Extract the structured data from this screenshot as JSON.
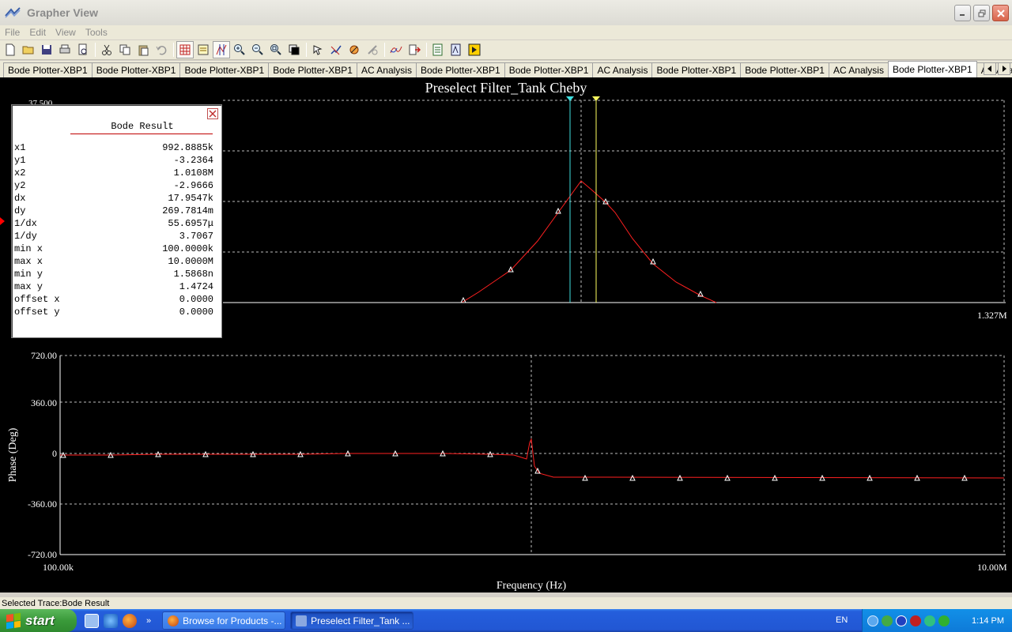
{
  "window": {
    "title": "Grapher View"
  },
  "menu": [
    "File",
    "Edit",
    "View",
    "Tools"
  ],
  "tabs": [
    {
      "label": "Bode Plotter-XBP1",
      "active": false
    },
    {
      "label": "Bode Plotter-XBP1",
      "active": false
    },
    {
      "label": "Bode Plotter-XBP1",
      "active": false
    },
    {
      "label": "Bode Plotter-XBP1",
      "active": false
    },
    {
      "label": "AC Analysis",
      "active": false
    },
    {
      "label": "Bode Plotter-XBP1",
      "active": false
    },
    {
      "label": "Bode Plotter-XBP1",
      "active": false
    },
    {
      "label": "AC Analysis",
      "active": false
    },
    {
      "label": "Bode Plotter-XBP1",
      "active": false
    },
    {
      "label": "Bode Plotter-XBP1",
      "active": false
    },
    {
      "label": "AC Analysis",
      "active": false
    },
    {
      "label": "Bode Plotter-XBP1",
      "active": true
    },
    {
      "label": "AC Analysis",
      "active": false
    }
  ],
  "plot": {
    "title": "Preselect Filter_Tank Cheby",
    "top_y_label_partial": "37.500",
    "top_right_x_label": "1.327M",
    "bottom_ylabel": "Phase (Deg)",
    "xlabel": "Frequency (Hz)",
    "x_min_label": "100.00k",
    "x_max_label": "10.00M",
    "phase_ticks": [
      "720.00",
      "360.00",
      "0",
      "-360.00",
      "-720.00"
    ]
  },
  "result": {
    "heading": "Bode Result",
    "rows": [
      {
        "k": "x1",
        "v": "992.8885k"
      },
      {
        "k": "y1",
        "v": "-3.2364"
      },
      {
        "k": "x2",
        "v": "1.0108M"
      },
      {
        "k": "y2",
        "v": "-2.9666"
      },
      {
        "k": "dx",
        "v": "17.9547k"
      },
      {
        "k": "dy",
        "v": "269.7814m"
      },
      {
        "k": "1/dx",
        "v": "55.6957μ"
      },
      {
        "k": "1/dy",
        "v": "3.7067"
      },
      {
        "k": "min x",
        "v": "100.0000k"
      },
      {
        "k": "max x",
        "v": "10.0000M"
      },
      {
        "k": "min y",
        "v": "1.5868n"
      },
      {
        "k": "max y",
        "v": "1.4724"
      },
      {
        "k": "offset x",
        "v": "0.0000"
      },
      {
        "k": "offset y",
        "v": "0.0000"
      }
    ]
  },
  "status": {
    "text": "Selected Trace:Bode Result"
  },
  "taskbar": {
    "start_label": "start",
    "tasks": [
      {
        "label": "Browse for Products -...",
        "active": false
      },
      {
        "label": "Preselect Filter_Tank ...",
        "active": true
      }
    ],
    "lang": "EN",
    "clock": "1:14 PM"
  },
  "chart_data": [
    {
      "type": "line",
      "title": "Preselect Filter_Tank Cheby",
      "xlabel": "",
      "ylabel": "",
      "x_scale": "log",
      "series": [
        {
          "color": "#ff2020",
          "x": [
            600000,
            700000,
            800000,
            900000,
            960000,
            1000000,
            1040000,
            1100000,
            1200000,
            1300000
          ],
          "y": [
            0.0,
            0.22,
            0.47,
            0.79,
            1.0,
            1.0,
            0.82,
            0.43,
            0.11,
            0.0
          ]
        }
      ],
      "cursors_x": [
        992888.5,
        1010800
      ]
    },
    {
      "type": "line",
      "title": "",
      "xlabel": "Frequency (Hz)",
      "ylabel": "Phase (Deg)",
      "x_scale": "log",
      "xlim": [
        100000,
        10000000
      ],
      "ylim": [
        -720,
        720
      ],
      "yticks": [
        720,
        360,
        0,
        -360,
        -720
      ],
      "series": [
        {
          "color": "#ff2020",
          "x": [
            100000,
            300000,
            600000,
            900000,
            990000,
            1000000,
            1020000,
            1100000,
            1400000,
            3000000,
            10000000
          ],
          "y": [
            -4,
            -4,
            -3,
            -5,
            -10,
            90,
            -140,
            -175,
            -176,
            -176,
            -176
          ]
        }
      ]
    }
  ]
}
